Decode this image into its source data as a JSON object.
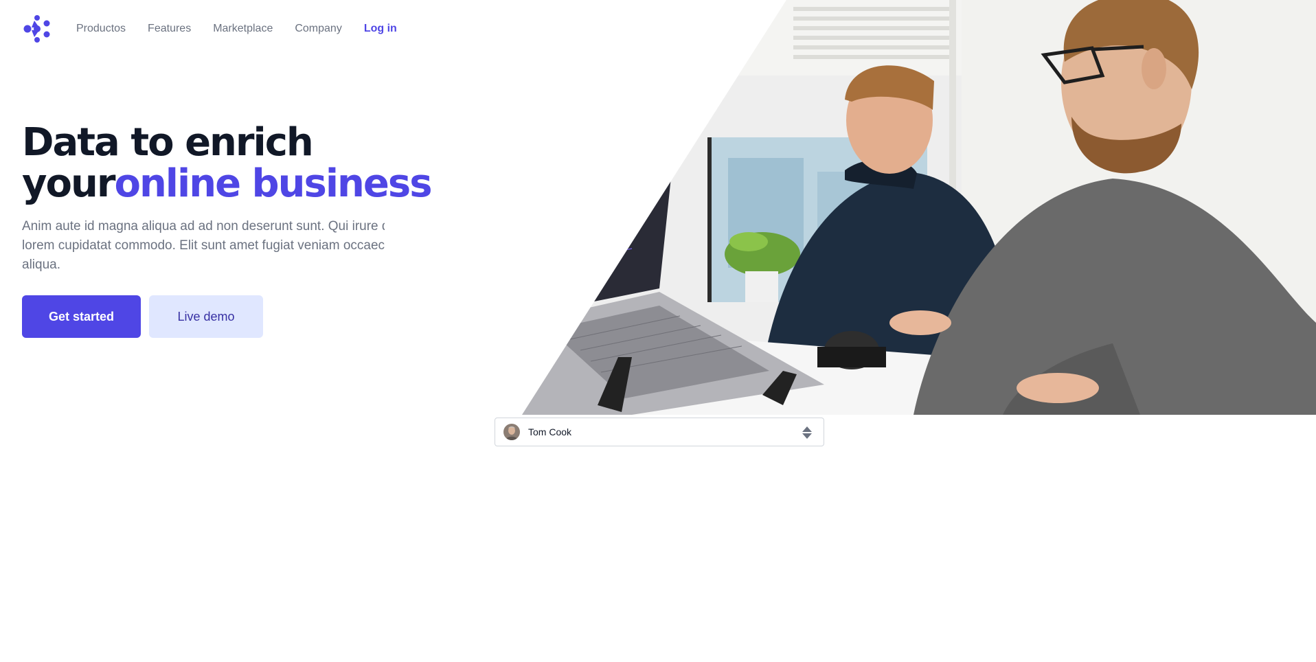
{
  "nav": {
    "logo_icon": "brand-logo-icon",
    "links": [
      "Productos",
      "Features",
      "Marketplace",
      "Company"
    ],
    "login": "Log in"
  },
  "hero": {
    "title_line1": "Data to enrich",
    "title_line2_plain": "your",
    "title_line2_accent": "online business",
    "subtitle": "Anim aute id magna aliqua ad ad non deserunt sunt. Qui irure qui lorem cupidatat commodo. Elit sunt amet fugiat veniam occaecat fugiat aliqua.",
    "primary_cta": "Get started",
    "secondary_cta": "Live demo",
    "image": "office-workers-at-laptops-photo"
  },
  "select": {
    "selected": "Tom Cook",
    "avatar_icon": "user-avatar",
    "chevron_icon": "chevron-up-down-icon"
  },
  "colors": {
    "accent": "#4f46e5",
    "accent_light": "#e0e7ff",
    "heading": "#111827",
    "muted": "#6b7280"
  }
}
